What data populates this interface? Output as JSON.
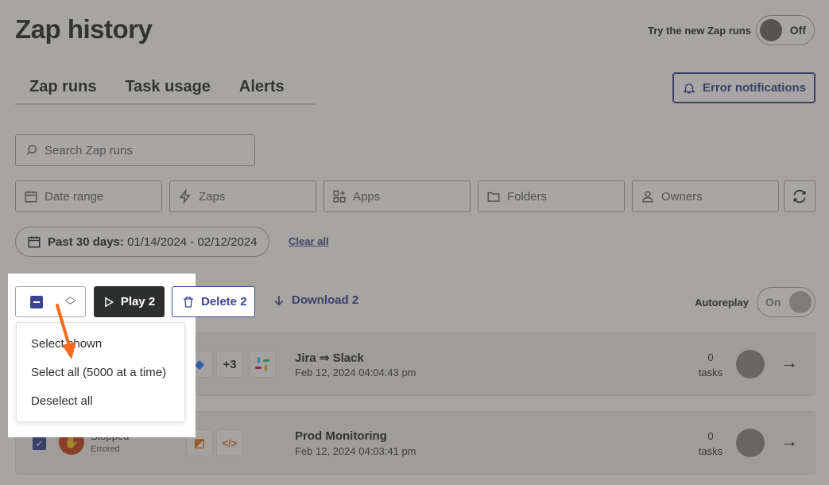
{
  "header": {
    "title": "Zap history",
    "new_runs_label": "Try the new Zap runs",
    "new_runs_state": "Off"
  },
  "tabs": [
    {
      "label": "Zap runs"
    },
    {
      "label": "Task usage"
    },
    {
      "label": "Alerts"
    }
  ],
  "error_notifications_label": "Error notifications",
  "search": {
    "placeholder": "Search Zap runs"
  },
  "filters": [
    {
      "label": "Date range",
      "icon": "calendar-icon"
    },
    {
      "label": "Zaps",
      "icon": "bolt-icon"
    },
    {
      "label": "Apps",
      "icon": "apps-icon"
    },
    {
      "label": "Folders",
      "icon": "folder-icon"
    },
    {
      "label": "Owners",
      "icon": "person-icon"
    }
  ],
  "date_chip": {
    "bold": "Past 30 days:",
    "range": "01/14/2024 - 02/12/2024"
  },
  "clear_all": "Clear all",
  "bulk": {
    "play_label": "Play 2",
    "delete_label": "Delete 2",
    "download_label": "Download 2"
  },
  "autoreplay": {
    "label": "Autoreplay",
    "state": "On"
  },
  "menu": [
    {
      "label": "Select shown"
    },
    {
      "label": "Select all (5000 at a time)"
    },
    {
      "label": "Deselect all"
    }
  ],
  "rows": [
    {
      "title": "Jira ⇒ Slack",
      "date": "Feb 12, 2024 04:04:43 pm",
      "tasks_count": "0",
      "tasks_label": "tasks",
      "extra_apps": "+3"
    },
    {
      "title": "Prod Monitoring",
      "date": "Feb 12, 2024 04:03:41 pm",
      "tasks_count": "0",
      "tasks_label": "tasks",
      "status": "Stopped",
      "substatus": "Errored"
    }
  ]
}
